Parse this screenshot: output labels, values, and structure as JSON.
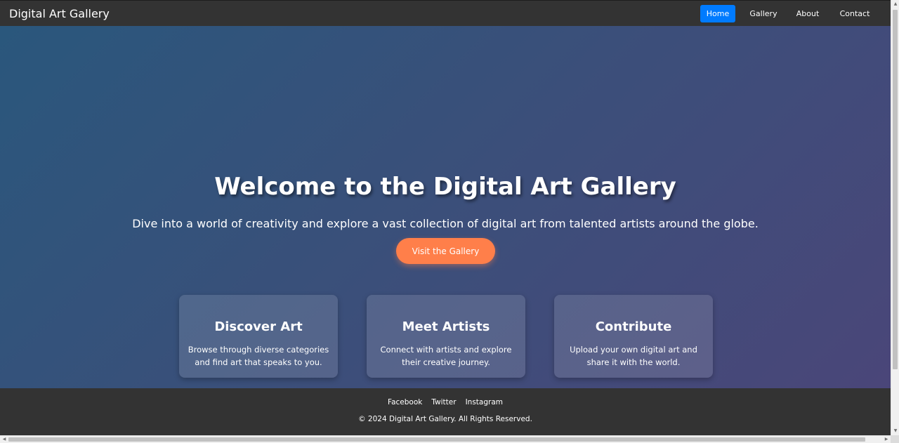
{
  "navbar": {
    "brand": "Digital Art Gallery",
    "links": [
      {
        "label": "Home",
        "active": true
      },
      {
        "label": "Gallery",
        "active": false
      },
      {
        "label": "About",
        "active": false
      },
      {
        "label": "Contact",
        "active": false
      }
    ]
  },
  "hero": {
    "title": "Welcome to the Digital Art Gallery",
    "subtitle": "Dive into a world of creativity and explore a vast collection of digital art from talented artists around the globe.",
    "cta_label": "Visit the Gallery"
  },
  "features": [
    {
      "title": "Discover Art",
      "text": "Browse through diverse categories and find art that speaks to you."
    },
    {
      "title": "Meet Artists",
      "text": "Connect with artists and explore their creative journey."
    },
    {
      "title": "Contribute",
      "text": "Upload your own digital art and share it with the world."
    }
  ],
  "footer": {
    "links": [
      "Facebook",
      "Twitter",
      "Instagram"
    ],
    "copyright": "© 2024 Digital Art Gallery. All Rights Reserved."
  },
  "colors": {
    "nav_active": "#007bff",
    "cta": "#ff7f4a",
    "bar_background": "#333333"
  }
}
